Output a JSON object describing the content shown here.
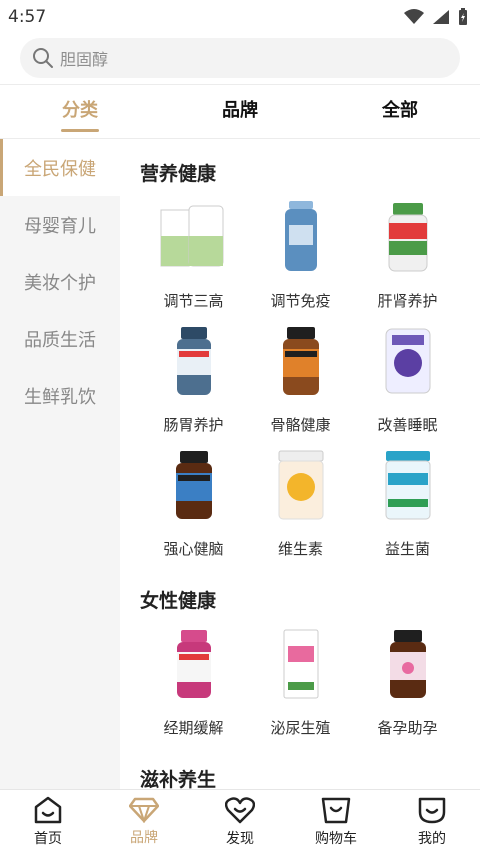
{
  "status": {
    "time": "4:57"
  },
  "search": {
    "placeholder": "胆固醇"
  },
  "top_tabs": [
    {
      "label": "分类",
      "active": true
    },
    {
      "label": "品牌",
      "active": false
    },
    {
      "label": "全部",
      "active": false
    }
  ],
  "sidebar": {
    "items": [
      {
        "label": "全民保健",
        "active": true
      },
      {
        "label": "母婴育儿",
        "active": false
      },
      {
        "label": "美妆个护",
        "active": false
      },
      {
        "label": "品质生活",
        "active": false
      },
      {
        "label": "生鲜乳饮",
        "active": false
      }
    ]
  },
  "sections": [
    {
      "title": "营养健康",
      "items": [
        {
          "label": "调节三高",
          "icon": "bottle-green-pack",
          "color": "#b7d99a"
        },
        {
          "label": "调节免疫",
          "icon": "capsule-bottle-blue",
          "color": "#5b8fbf"
        },
        {
          "label": "肝肾养护",
          "icon": "bottle-green-label",
          "color": "#4b9b48"
        },
        {
          "label": "肠胃养护",
          "icon": "bottle-dark-blue",
          "color": "#4d6f8f"
        },
        {
          "label": "骨骼健康",
          "icon": "bottle-orange",
          "color": "#e0812a"
        },
        {
          "label": "改善睡眠",
          "icon": "jar-purple",
          "color": "#5b3fa3"
        },
        {
          "label": "强心健脑",
          "icon": "bottle-blue-brown",
          "color": "#3b7fc4"
        },
        {
          "label": "维生素",
          "icon": "jar-yellow",
          "color": "#f3b52b"
        },
        {
          "label": "益生菌",
          "icon": "jar-blue-green",
          "color": "#2aa3c8"
        }
      ]
    },
    {
      "title": "女性健康",
      "items": [
        {
          "label": "经期缓解",
          "icon": "bottle-pink",
          "color": "#d64b8c"
        },
        {
          "label": "泌尿生殖",
          "icon": "box-pink",
          "color": "#e86a9e"
        },
        {
          "label": "备孕助孕",
          "icon": "bottle-brown-pink",
          "color": "#e86aa0"
        }
      ]
    },
    {
      "title": "滋补养生",
      "items": []
    }
  ],
  "bottom_nav": [
    {
      "label": "首页",
      "icon": "home-icon",
      "active": false
    },
    {
      "label": "品牌",
      "icon": "diamond-icon",
      "active": true
    },
    {
      "label": "发现",
      "icon": "heart-icon",
      "active": false
    },
    {
      "label": "购物车",
      "icon": "cart-icon",
      "active": false
    },
    {
      "label": "我的",
      "icon": "profile-icon",
      "active": false
    }
  ],
  "colors": {
    "accent": "#c9a676"
  }
}
